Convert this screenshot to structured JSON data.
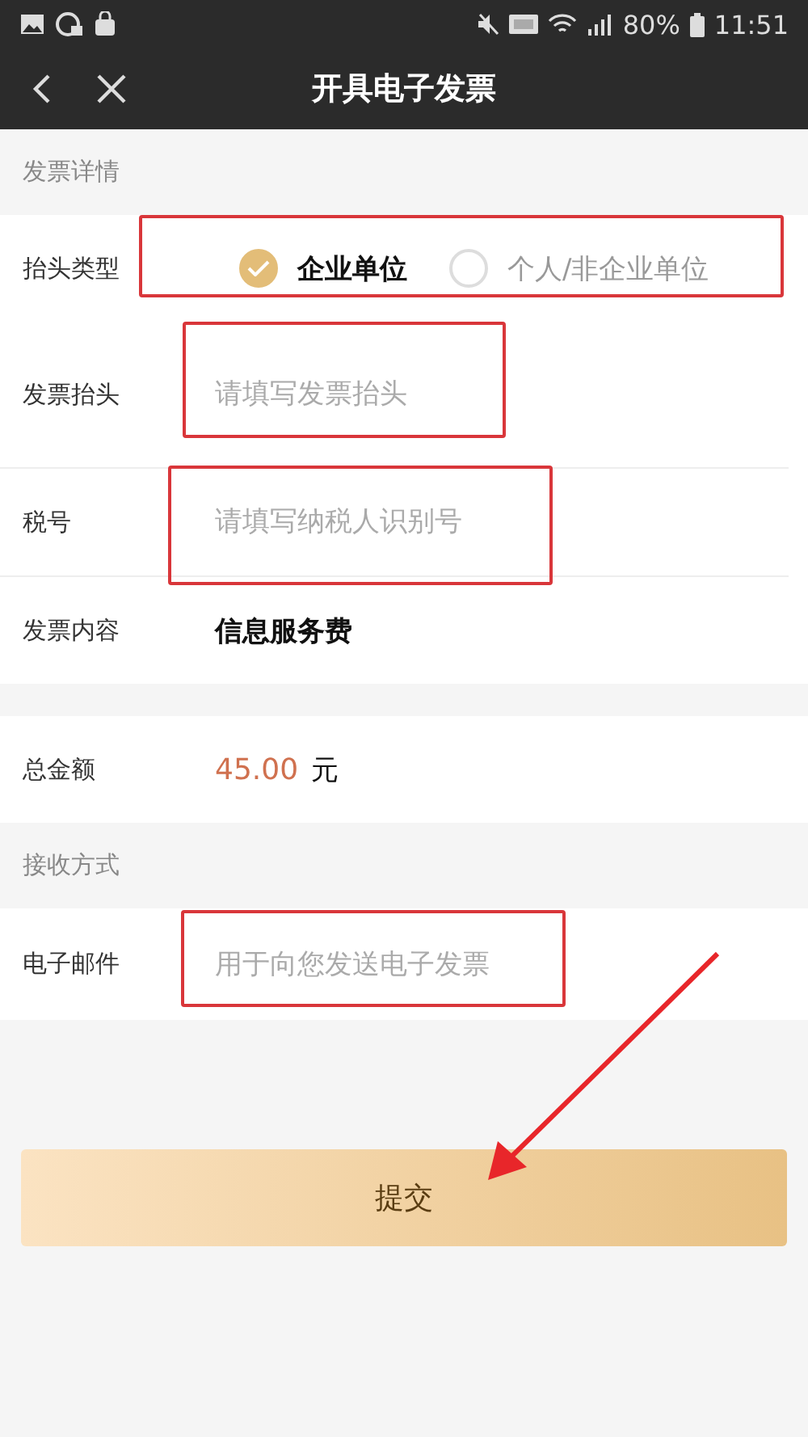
{
  "status_bar": {
    "battery": "80%",
    "time": "11:51"
  },
  "nav": {
    "title": "开具电子发票"
  },
  "details": {
    "header": "发票详情",
    "title_type": {
      "label": "抬头类型",
      "options": [
        {
          "label": "企业单位",
          "selected": true
        },
        {
          "label": "个人/非企业单位",
          "selected": false
        }
      ]
    },
    "fields": [
      {
        "label": "发票抬头",
        "placeholder": "请填写发票抬头"
      },
      {
        "label": "税号",
        "placeholder": "请填写纳税人识别号"
      }
    ],
    "content": {
      "label": "发票内容",
      "value": "信息服务费"
    }
  },
  "total": {
    "label": "总金额",
    "amount": "45.00",
    "unit": "元"
  },
  "delivery": {
    "header": "接收方式",
    "field": {
      "label": "电子邮件",
      "placeholder": "用于向您发送电子发票"
    }
  },
  "submit": "提交"
}
